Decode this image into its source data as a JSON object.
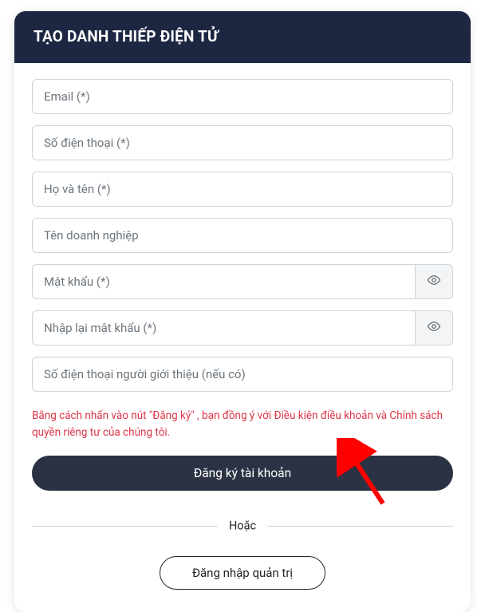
{
  "header": {
    "title": "TẠO DANH THIẾP ĐIỆN TỬ"
  },
  "form": {
    "email_placeholder": "Email (*)",
    "phone_placeholder": "Số điện thoại (*)",
    "name_placeholder": "Họ và tên (*)",
    "business_placeholder": "Tên doanh nghiệp",
    "password_placeholder": "Mật khẩu (*)",
    "confirm_password_placeholder": "Nhập lại mật khẩu (*)",
    "referral_placeholder": "Số điện thoại người giới thiệu (nếu có)"
  },
  "terms": "Bằng cách nhấn vào nút \"Đăng ký\" , bạn đồng ý với Điều kiện điều khoản và Chính sách quyền riêng tư của chúng tôi.",
  "actions": {
    "register_label": "Đăng ký tài khoản",
    "divider_label": "Hoặc",
    "admin_login_label": "Đăng nhập quản trị"
  },
  "colors": {
    "header_bg": "#1e2742",
    "primary_btn": "#2b3243",
    "danger": "#dc3545",
    "border": "#ced4da",
    "append_bg": "#f2f4f6",
    "arrow": "#ff0000"
  }
}
